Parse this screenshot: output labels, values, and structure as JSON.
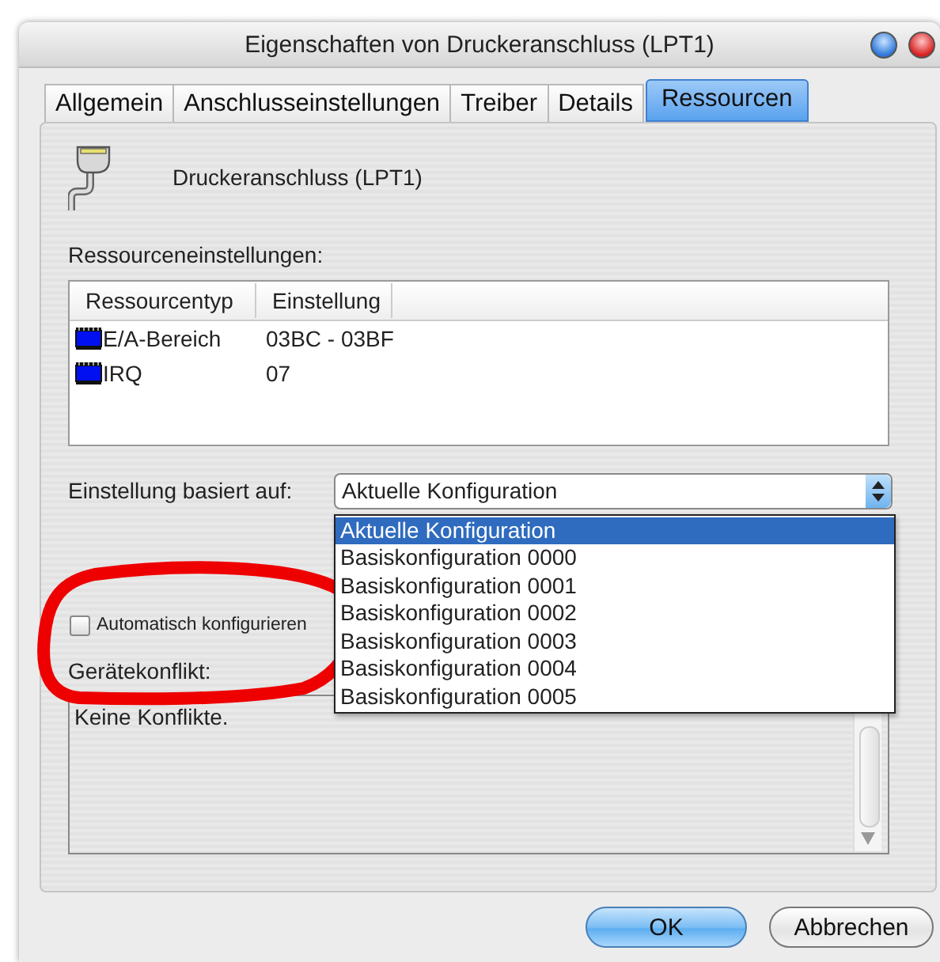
{
  "window": {
    "title": "Eigenschaften von Druckeranschluss (LPT1)"
  },
  "tabs": [
    {
      "label": "Allgemein",
      "selected": false
    },
    {
      "label": "Anschlusseinstellungen",
      "selected": false
    },
    {
      "label": "Treiber",
      "selected": false
    },
    {
      "label": "Details",
      "selected": false
    },
    {
      "label": "Ressourcen",
      "selected": true
    }
  ],
  "device": {
    "name": "Druckeranschluss (LPT1)"
  },
  "resources": {
    "label": "Ressourceneinstellungen:",
    "columns": [
      "Ressourcentyp",
      "Einstellung"
    ],
    "rows": [
      {
        "type": "E/A-Bereich",
        "setting": "03BC - 03BF"
      },
      {
        "type": "IRQ",
        "setting": "07"
      }
    ]
  },
  "setting_based_on": {
    "label": "Einstellung basiert auf:",
    "value": "Aktuelle Konfiguration",
    "expanded": true,
    "options": [
      {
        "label": "Aktuelle Konfiguration",
        "selected": true
      },
      {
        "label": "Basiskonfiguration 0000",
        "selected": false
      },
      {
        "label": "Basiskonfiguration 0001",
        "selected": false
      },
      {
        "label": "Basiskonfiguration 0002",
        "selected": false
      },
      {
        "label": "Basiskonfiguration 0003",
        "selected": false
      },
      {
        "label": "Basiskonfiguration 0004",
        "selected": false
      },
      {
        "label": "Basiskonfiguration 0005",
        "selected": false
      }
    ]
  },
  "auto_configure": {
    "label": "Automatisch konfigurieren",
    "checked": false
  },
  "conflict": {
    "label": "Gerätekonflikt:",
    "text": "Keine Konflikte."
  },
  "buttons": [
    {
      "label": "OK",
      "default": true
    },
    {
      "label": "Abbrechen",
      "default": false
    }
  ]
}
